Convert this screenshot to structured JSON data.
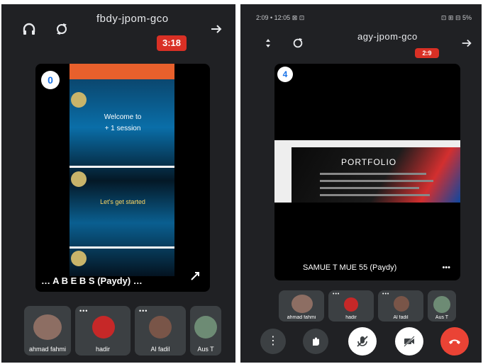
{
  "left": {
    "meeting_code": "fbdy-jpom-gco",
    "badge": "3:18",
    "pinned_number": "0",
    "presentation_label": "… A B E B S (Paydy) …",
    "screen_lines": {
      "line1": "Welcome to",
      "line2": "+ 1 session",
      "line3": "Let's get started"
    },
    "participants": [
      {
        "name": "ahmad fahmi",
        "color": "#8d6e63"
      },
      {
        "name": "hadir",
        "color": "#c62828"
      },
      {
        "name": "Al fadil",
        "color": "#795548"
      },
      {
        "name": "Aus T",
        "color": "#6d8b74"
      }
    ]
  },
  "right": {
    "status_left": "2:09 • 12:05 ⊠ ⊡",
    "status_right": "⊡ ⊞ ⊟ 5%",
    "meeting_code": "agy-jpom-gco",
    "badge": "2:9",
    "pinned_number": "4",
    "slide_title": "PORTFOLIO",
    "presentation_label": "SAMUE T MUE 55 (Paydy)",
    "participants": [
      {
        "name": "ahmad fahmi",
        "color": "#8d6e63"
      },
      {
        "name": "hadir",
        "color": "#c62828"
      },
      {
        "name": "Al fadil",
        "color": "#795548"
      },
      {
        "name": "Aus T",
        "color": "#6d8b74"
      }
    ]
  }
}
